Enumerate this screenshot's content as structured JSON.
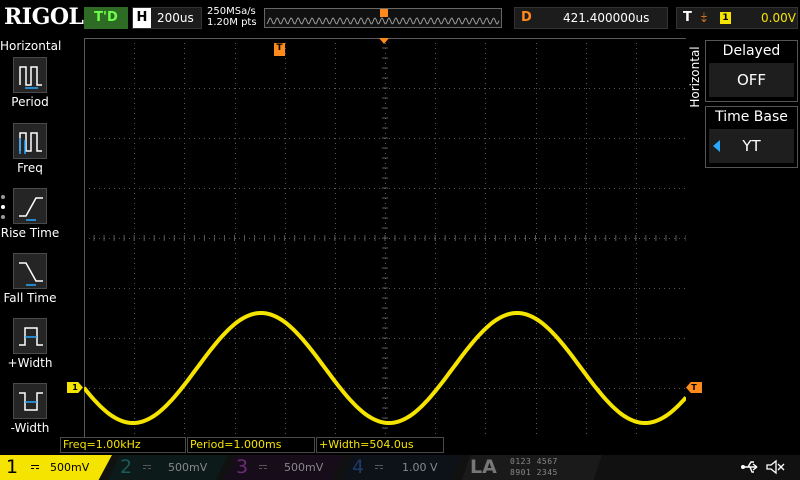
{
  "header": {
    "brand": "RIGOL",
    "trigger_status": "T'D",
    "timebase_label": "H",
    "timebase_value": "200us",
    "sample_rate": "250MSa/s",
    "memory_depth": "1.20M pts",
    "memory_trigger_marker": "T",
    "delay_label": "D",
    "delay_value": "421.400000us",
    "trigger_label": "T",
    "trigger_slope_symbol": "⤈",
    "trigger_source": "1",
    "trigger_level": "0.00V"
  },
  "left_menu": {
    "title": "Horizontal",
    "items": [
      {
        "label": "Period",
        "icon": "period-icon"
      },
      {
        "label": "Freq",
        "icon": "frequency-icon"
      },
      {
        "label": "Rise Time",
        "icon": "rise-time-icon"
      },
      {
        "label": "Fall Time",
        "icon": "fall-time-icon"
      },
      {
        "label": "+Width",
        "icon": "positive-width-icon"
      },
      {
        "label": "-Width",
        "icon": "negative-width-icon"
      }
    ]
  },
  "right_menu": {
    "title": "Horizontal",
    "delayed": {
      "title": "Delayed",
      "value": "OFF"
    },
    "time_base": {
      "title": "Time Base",
      "value": "YT"
    }
  },
  "display": {
    "trigger_position_marker": "T",
    "channel1_marker": "1",
    "trigger_level_marker": "T",
    "waveform_color": "#f5e400",
    "trigger_color": "#ff8a1c",
    "grid_color": "#5a5a5a"
  },
  "measurements": [
    {
      "text": "Freq=1.00kHz"
    },
    {
      "text": "Period=1.000ms"
    },
    {
      "text": "+Width=504.0us"
    }
  ],
  "channels": [
    {
      "number": "1",
      "scale": "500mV",
      "color": "#f5e400"
    },
    {
      "number": "2",
      "scale": "500mV",
      "color": "#1c8a8a"
    },
    {
      "number": "3",
      "scale": "500mV",
      "color": "#9b3fb0"
    },
    {
      "number": "4",
      "scale": "1.00 V",
      "color": "#2f5fb5"
    }
  ],
  "logic_analyzer": {
    "label": "LA",
    "row1": "0123 4567",
    "row2": "8901 2345"
  },
  "status_icons": [
    "usb-icon",
    "speaker-muted-icon"
  ]
}
